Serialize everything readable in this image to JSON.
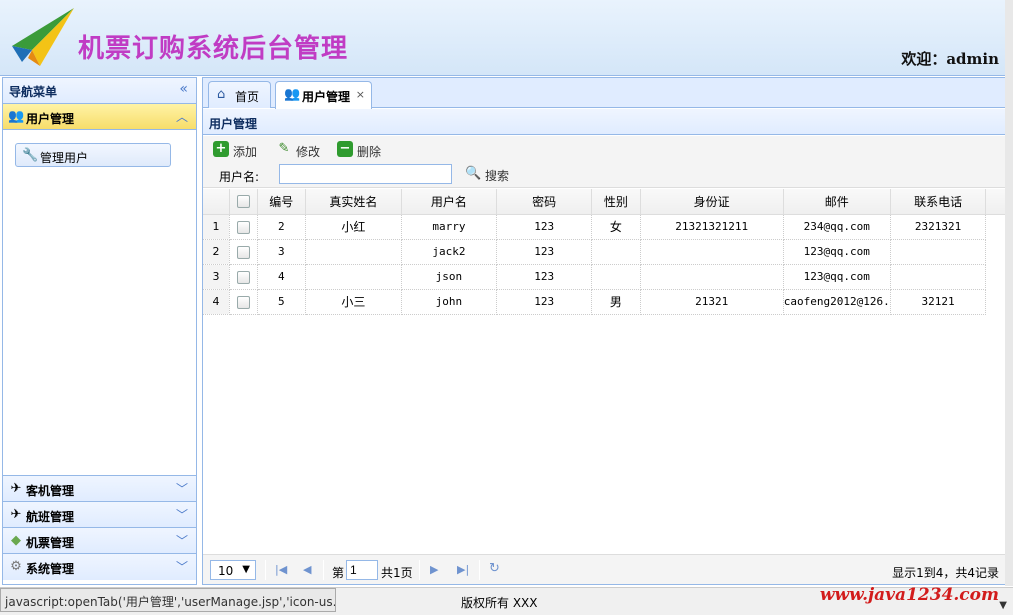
{
  "header": {
    "title": "机票订购系统后台管理",
    "welcome": "欢迎：admin"
  },
  "nav": {
    "title": "导航菜单",
    "collapse_icon": "«",
    "active_section": {
      "label": "用户管理",
      "icon": "users-icon",
      "arrow": "︿"
    },
    "items": [
      {
        "label": "管理用户",
        "icon": "tools-icon"
      }
    ],
    "sections": [
      {
        "label": "客机管理",
        "icon": "airplane-icon",
        "arrow": "﹀"
      },
      {
        "label": "航班管理",
        "icon": "flight-icon",
        "arrow": "﹀"
      },
      {
        "label": "机票管理",
        "icon": "ticket-icon",
        "arrow": "﹀"
      },
      {
        "label": "系统管理",
        "icon": "gear-icon",
        "arrow": "﹀"
      }
    ]
  },
  "tabs": [
    {
      "label": "首页",
      "icon": "home-icon"
    },
    {
      "label": "用户管理",
      "icon": "users-icon",
      "close": "×"
    }
  ],
  "panel": {
    "title": "用户管理"
  },
  "toolbar": {
    "add_label": "添加",
    "edit_label": "修改",
    "delete_label": "删除",
    "search_label": "用户名:",
    "search_value": "",
    "search_button": "搜索"
  },
  "grid": {
    "columns": [
      "编号",
      "真实姓名",
      "用户名",
      "密码",
      "性别",
      "身份证",
      "邮件",
      "联系电话"
    ],
    "rows": [
      {
        "rn": "1",
        "id": "2",
        "realname": "小红",
        "username": "marry",
        "password": "123",
        "sex": "女",
        "idcard": "21321321211",
        "email": "234@qq.com",
        "phone": "2321321"
      },
      {
        "rn": "2",
        "id": "3",
        "realname": "",
        "username": "jack2",
        "password": "123",
        "sex": "",
        "idcard": "",
        "email": "123@qq.com",
        "phone": ""
      },
      {
        "rn": "3",
        "id": "4",
        "realname": "",
        "username": "json",
        "password": "123",
        "sex": "",
        "idcard": "",
        "email": "123@qq.com",
        "phone": ""
      },
      {
        "rn": "4",
        "id": "5",
        "realname": "小三",
        "username": "john",
        "password": "123",
        "sex": "男",
        "idcard": "21321",
        "email": "caofeng2012@126.",
        "phone": "32121"
      }
    ]
  },
  "pager": {
    "page_size": "10",
    "page_prefix": "第",
    "page_value": "1",
    "page_total": "共1页",
    "info": "显示1到4，共4记录"
  },
  "footer": {
    "status_url": "javascript:openTab('用户管理','userManage.jsp','icon-us...",
    "copyright": "版权所有 XXX",
    "watermark": "www.java1234.com"
  },
  "colors": {
    "title": "#c03cc4",
    "border": "#95b8e7",
    "active_section": "#f7dd6a",
    "watermark": "#d21b1b"
  }
}
